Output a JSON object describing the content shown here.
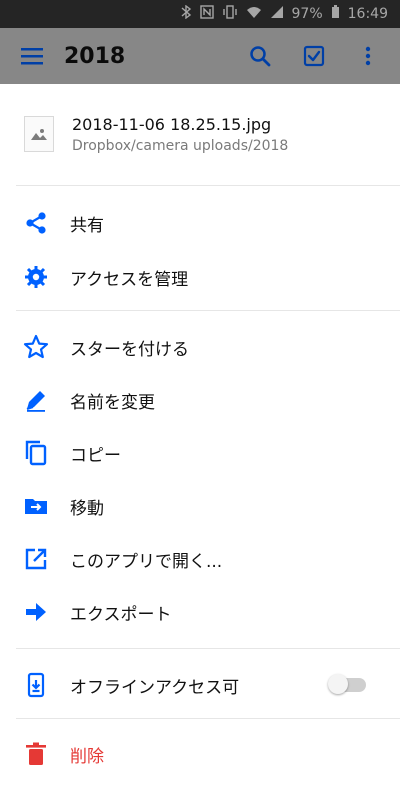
{
  "status_bar": {
    "battery_pct": "97%",
    "time": "16:49",
    "icons": [
      "bluetooth-icon",
      "nfc-icon",
      "vibrate-icon",
      "wifi-icon",
      "signal-icon",
      "battery-icon"
    ]
  },
  "app_bar": {
    "title": "2018",
    "icons": [
      "menu-icon",
      "search-icon",
      "select-icon",
      "more-vert-icon"
    ]
  },
  "file": {
    "name": "2018-11-06 18.25.15.jpg",
    "path": "Dropbox/camera uploads/2018",
    "thumbnail_icon": "image-icon"
  },
  "menu": [
    {
      "label": "共有",
      "icon": "share-icon"
    },
    {
      "label": "アクセスを管理",
      "icon": "gear-icon"
    },
    {
      "label": "スターを付ける",
      "icon": "star-outline-icon"
    },
    {
      "label": "名前を変更",
      "icon": "pencil-icon"
    },
    {
      "label": "コピー",
      "icon": "copy-icon"
    },
    {
      "label": "移動",
      "icon": "folder-move-icon"
    },
    {
      "label": "このアプリで開く...",
      "icon": "open-external-icon"
    },
    {
      "label": "エクスポート",
      "icon": "arrow-right-icon"
    },
    {
      "label": "オフラインアクセス可",
      "icon": "offline-download-icon",
      "toggle": false
    },
    {
      "label": "削除",
      "icon": "trash-icon"
    }
  ],
  "colors": {
    "accent": "#0061ff",
    "danger": "#e53935"
  }
}
